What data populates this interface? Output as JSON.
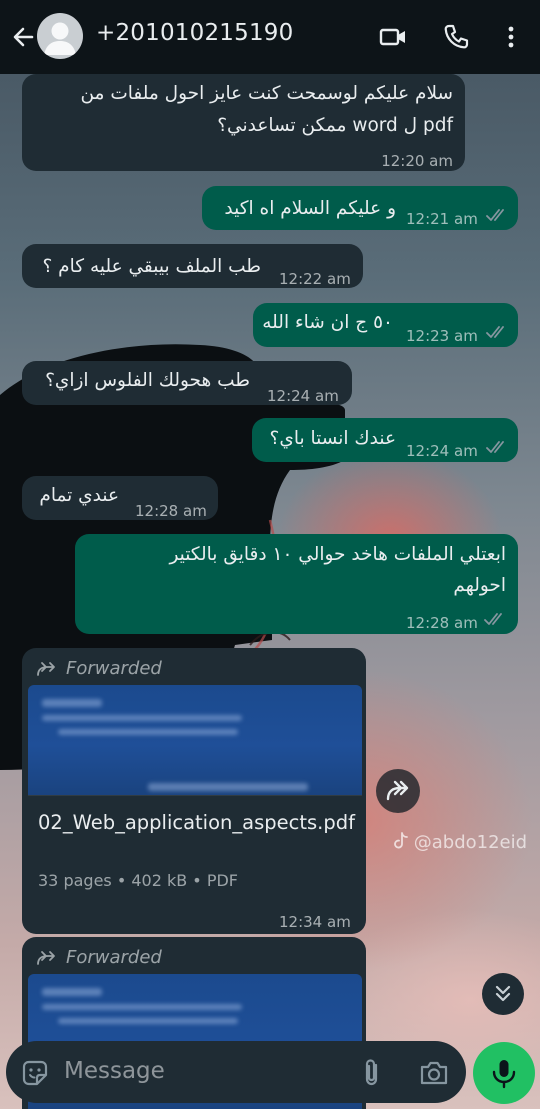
{
  "header": {
    "title": "+201010215190",
    "back_icon": "arrow-left-icon",
    "avatar_icon": "person-avatar-icon",
    "video_icon": "video-call-icon",
    "call_icon": "phone-icon",
    "menu_icon": "more-vertical-icon"
  },
  "messages": [
    {
      "dir": "in",
      "lines": [
        "سلام عليكم لوسمحت كنت عايز احول ملفات من",
        "pdf ل word ممكن تساعدني؟"
      ],
      "time": "12:20 am"
    },
    {
      "dir": "out",
      "text": "و عليكم السلام اه اكيد",
      "time": "12:21 am",
      "status": "read"
    },
    {
      "dir": "in",
      "text": "طب الملف بيبقي عليه كام ؟",
      "time": "12:22 am"
    },
    {
      "dir": "out",
      "text": "٥٠ ج ان شاء الله",
      "time": "12:23 am",
      "status": "read"
    },
    {
      "dir": "in",
      "text": "طب هحولك الفلوس ازاي؟",
      "time": "12:24 am"
    },
    {
      "dir": "out",
      "text": "عندك انستا باي؟",
      "time": "12:24 am",
      "status": "read"
    },
    {
      "dir": "in",
      "text": "عندي تمام",
      "time": "12:28 am"
    },
    {
      "dir": "out",
      "lines": [
        "ابعتلي الملفات هاخد حوالي ١٠ دقايق بالكتير",
        "احولهم"
      ],
      "time": "12:28 am",
      "status": "read"
    }
  ],
  "documents": [
    {
      "forwarded_label": "Forwarded",
      "filename": "02_Web_application_aspects.pdf",
      "meta": "33 pages • 402 kB • PDF",
      "time": "12:34 am"
    },
    {
      "forwarded_label": "Forwarded"
    }
  ],
  "watermark": "@abdo12eid",
  "composer": {
    "placeholder": "Message",
    "sticker_icon": "sticker-icon",
    "attach_icon": "paperclip-icon",
    "camera_icon": "camera-icon",
    "mic_icon": "microphone-icon"
  },
  "colors": {
    "header_bg": "#0d1418",
    "incoming_bubble": "#1f2c34",
    "outgoing_bubble": "#005c4b",
    "mic_button": "#21c063",
    "read_ticks": "#8696a0"
  }
}
